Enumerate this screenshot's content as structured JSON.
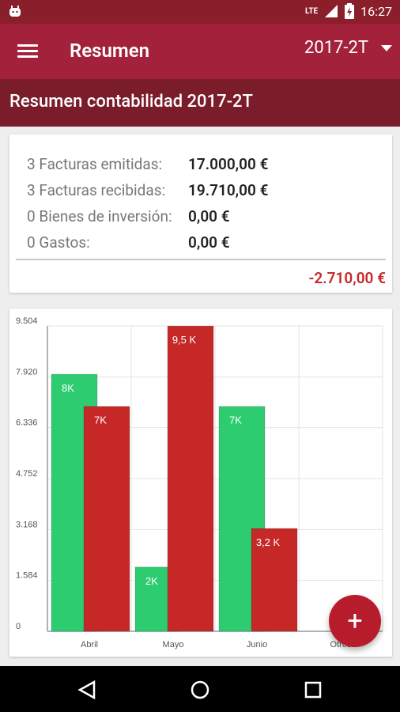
{
  "status_bar": {
    "network": "LTE",
    "time": "16:27"
  },
  "toolbar": {
    "title": "Resumen",
    "period": "2017-2T",
    "menu_icon": "hamburger-menu-icon",
    "dropdown_icon": "caret-down-icon"
  },
  "subheader": {
    "title": "Resumen contabilidad 2017-2T"
  },
  "summary": {
    "rows": [
      {
        "label": "3 Facturas emitidas:",
        "value": "17.000,00 €"
      },
      {
        "label": "3 Facturas recibidas:",
        "value": "19.710,00 €"
      },
      {
        "label": "0 Bienes de inversión:",
        "value": "0,00 €"
      },
      {
        "label": "0 Gastos:",
        "value": "0,00 €"
      }
    ],
    "total": "-2.710,00 €"
  },
  "chart_data": {
    "type": "bar",
    "categories": [
      "Abril",
      "Mayo",
      "Junio",
      "Otros"
    ],
    "series": [
      {
        "values": [
          8000,
          2000,
          7000,
          0
        ],
        "labels": [
          "8K",
          "2K",
          "7K",
          ""
        ],
        "color": "#2ecc71"
      },
      {
        "values": [
          7000,
          9500,
          3200,
          0
        ],
        "labels": [
          "7K",
          "9,5 K",
          "3,2 K",
          ""
        ],
        "color": "#c62828"
      }
    ],
    "ylim": [
      0,
      9504
    ],
    "yticks": [
      "0",
      "1.584",
      "3.168",
      "4.752",
      "6.336",
      "7.920",
      "9.504"
    ],
    "grid": true
  },
  "fab": {
    "label": "+",
    "icon": "plus-icon"
  },
  "nav_bar": {
    "icons": [
      "back-icon",
      "home-icon",
      "recents-icon"
    ]
  },
  "colors": {
    "status_bar": "#8a1f2b",
    "toolbar": "#a3213a",
    "subheader": "#7b1c2a",
    "income": "#2ecc71",
    "expense": "#c62828",
    "total": "#c62828"
  }
}
